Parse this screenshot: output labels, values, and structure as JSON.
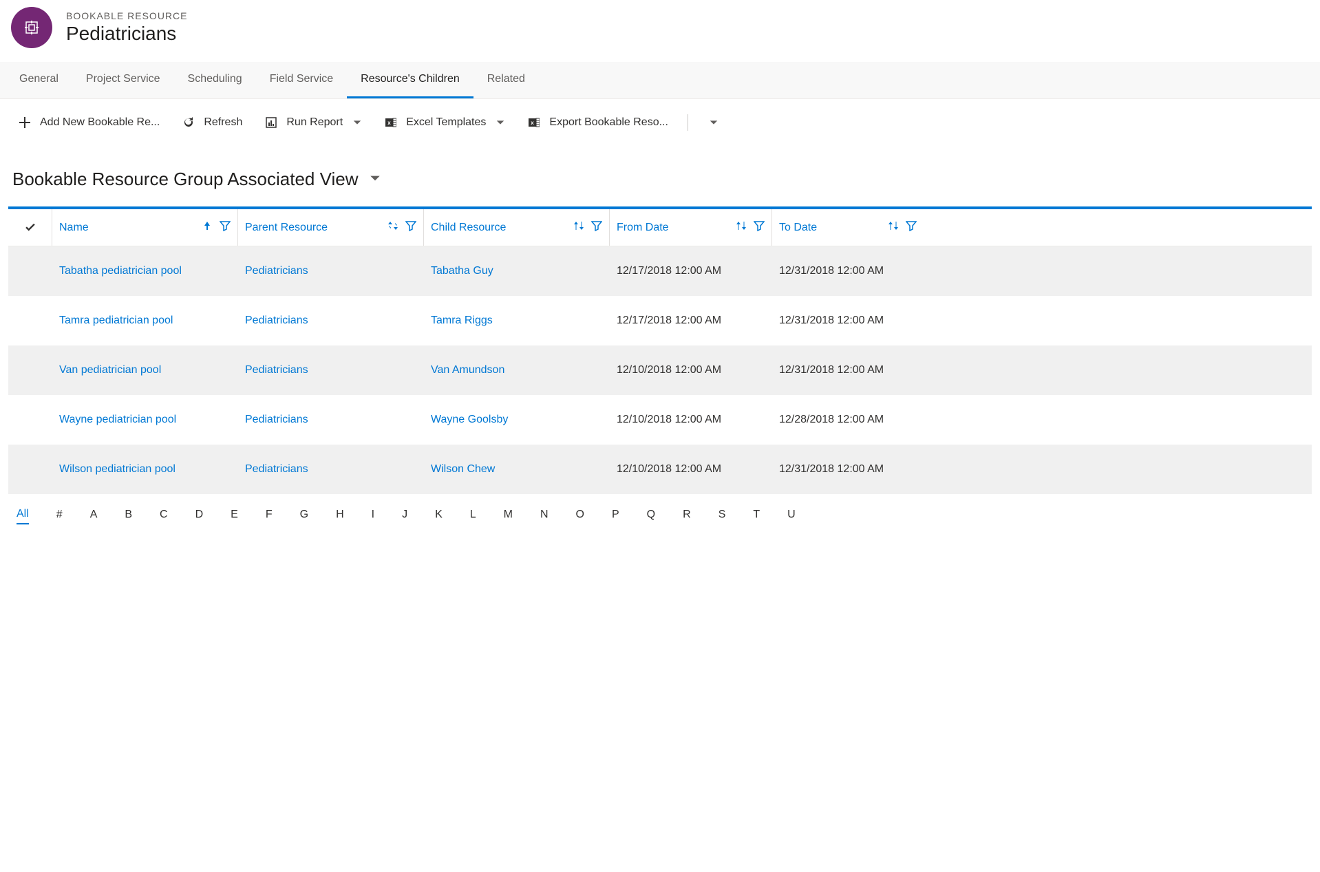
{
  "header": {
    "entity_type": "BOOKABLE RESOURCE",
    "entity_name": "Pediatricians"
  },
  "tabs": [
    {
      "label": "General",
      "active": false
    },
    {
      "label": "Project Service",
      "active": false
    },
    {
      "label": "Scheduling",
      "active": false
    },
    {
      "label": "Field Service",
      "active": false
    },
    {
      "label": "Resource's Children",
      "active": true
    },
    {
      "label": "Related",
      "active": false
    }
  ],
  "toolbar": {
    "add_new": "Add New Bookable Re...",
    "refresh": "Refresh",
    "run_report": "Run Report",
    "excel_templates": "Excel Templates",
    "export": "Export Bookable Reso..."
  },
  "view": {
    "title": "Bookable Resource Group Associated View"
  },
  "grid": {
    "columns": [
      {
        "label": "Name",
        "sort": "up"
      },
      {
        "label": "Parent Resource",
        "sort": "both"
      },
      {
        "label": "Child Resource",
        "sort": "both"
      },
      {
        "label": "From Date",
        "sort": "both"
      },
      {
        "label": "To Date",
        "sort": "both"
      }
    ],
    "rows": [
      {
        "name": "Tabatha pediatrician pool",
        "parent": "Pediatricians",
        "child": "Tabatha Guy",
        "from": "12/17/2018 12:00 AM",
        "to": "12/31/2018 12:00 AM"
      },
      {
        "name": "Tamra pediatrician pool",
        "parent": "Pediatricians",
        "child": "Tamra Riggs",
        "from": "12/17/2018 12:00 AM",
        "to": "12/31/2018 12:00 AM"
      },
      {
        "name": "Van pediatrician pool",
        "parent": "Pediatricians",
        "child": "Van Amundson",
        "from": "12/10/2018 12:00 AM",
        "to": "12/31/2018 12:00 AM"
      },
      {
        "name": "Wayne pediatrician pool",
        "parent": "Pediatricians",
        "child": "Wayne Goolsby",
        "from": "12/10/2018 12:00 AM",
        "to": "12/28/2018 12:00 AM"
      },
      {
        "name": "Wilson pediatrician pool",
        "parent": "Pediatricians",
        "child": "Wilson Chew",
        "from": "12/10/2018 12:00 AM",
        "to": "12/31/2018 12:00 AM"
      }
    ]
  },
  "alpha_index": [
    "All",
    "#",
    "A",
    "B",
    "C",
    "D",
    "E",
    "F",
    "G",
    "H",
    "I",
    "J",
    "K",
    "L",
    "M",
    "N",
    "O",
    "P",
    "Q",
    "R",
    "S",
    "T",
    "U"
  ]
}
